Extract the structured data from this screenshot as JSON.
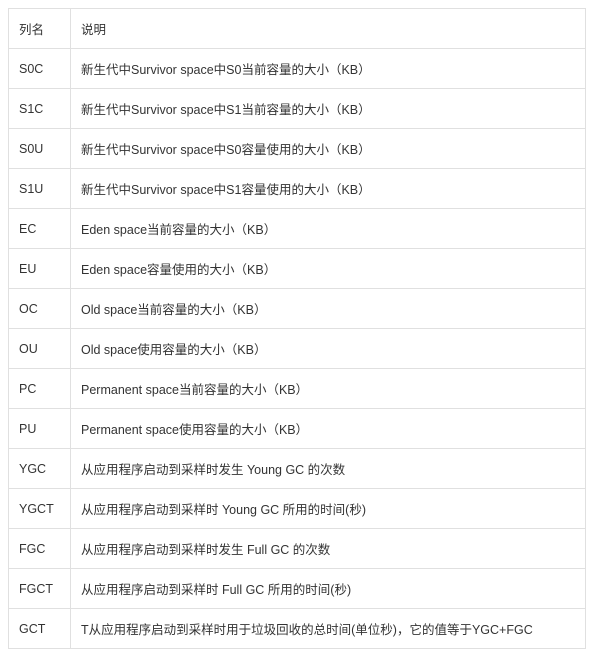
{
  "table": {
    "headers": {
      "col1": "列名",
      "col2": "说明"
    },
    "rows": [
      {
        "name": "S0C",
        "desc": "新生代中Survivor space中S0当前容量的大小（KB）"
      },
      {
        "name": "S1C",
        "desc": "新生代中Survivor space中S1当前容量的大小（KB）"
      },
      {
        "name": "S0U",
        "desc": "新生代中Survivor space中S0容量使用的大小（KB）"
      },
      {
        "name": "S1U",
        "desc": "新生代中Survivor space中S1容量使用的大小（KB）"
      },
      {
        "name": "EC",
        "desc": "Eden space当前容量的大小（KB）"
      },
      {
        "name": "EU",
        "desc": "Eden space容量使用的大小（KB）"
      },
      {
        "name": "OC",
        "desc": "Old space当前容量的大小（KB）"
      },
      {
        "name": "OU",
        "desc": "Old space使用容量的大小（KB）"
      },
      {
        "name": "PC",
        "desc": "Permanent space当前容量的大小（KB）"
      },
      {
        "name": "PU",
        "desc": "Permanent space使用容量的大小（KB）"
      },
      {
        "name": "YGC",
        "desc": "从应用程序启动到采样时发生 Young GC 的次数"
      },
      {
        "name": "YGCT",
        "desc": "从应用程序启动到采样时 Young GC 所用的时间(秒)"
      },
      {
        "name": "FGC",
        "desc": "从应用程序启动到采样时发生 Full GC 的次数"
      },
      {
        "name": "FGCT",
        "desc": "从应用程序启动到采样时 Full GC 所用的时间(秒)"
      },
      {
        "name": "GCT",
        "desc": "T从应用程序启动到采样时用于垃圾回收的总时间(单位秒)，它的值等于YGC+FGC"
      }
    ]
  },
  "watermark": ""
}
